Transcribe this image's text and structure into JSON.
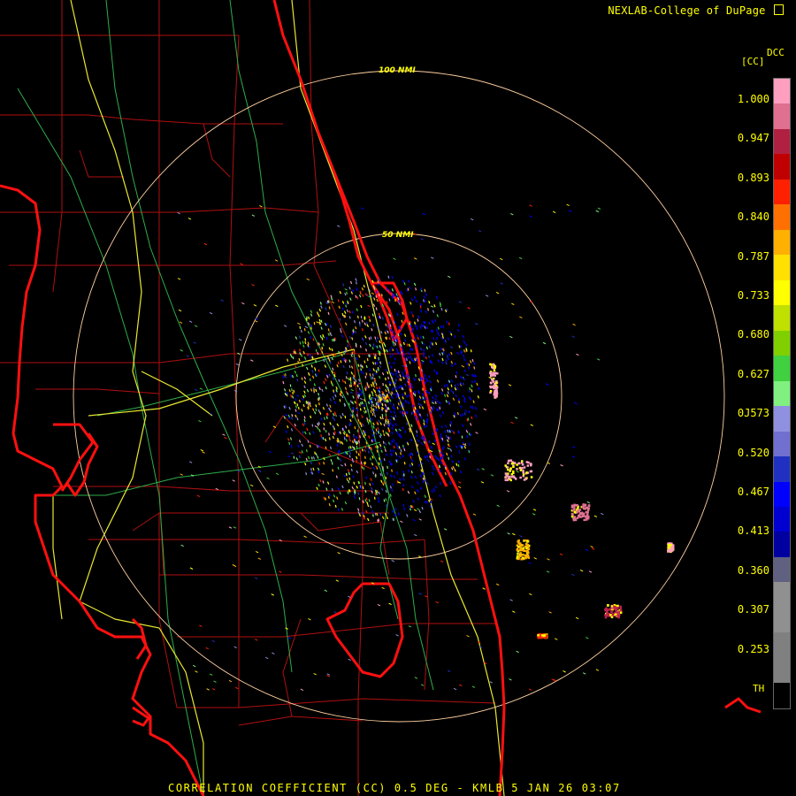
{
  "header": {
    "credit": "NEXLAB-College of DuPage",
    "credit_icon": "dcc-logo-mark"
  },
  "legend": {
    "unit": "[CC]",
    "logo_text": "DCC",
    "bottom_label": "TH",
    "ticks": [
      "1.000",
      "0.947",
      "0.893",
      "0.840",
      "0.787",
      "0.733",
      "0.680",
      "0.627",
      "0J573",
      "0.520",
      "0.467",
      "0.413",
      "0.360",
      "0.307",
      "0.253"
    ],
    "colors": [
      "#ff9fc0",
      "#e07090",
      "#b02040",
      "#c00000",
      "#ff2000",
      "#ff7000",
      "#ffb000",
      "#ffe000",
      "#ffff00",
      "#c0e000",
      "#80d000",
      "#40d040",
      "#80f080",
      "#9090e0",
      "#7070d0",
      "#2030c0",
      "#0000ff",
      "#0000d0",
      "#0000a0",
      "#606080",
      "#909090",
      "#909090",
      "#808080",
      "#808080",
      "#000000"
    ]
  },
  "map": {
    "range_ring_labels": [
      "100 NMI",
      "50 NMI"
    ],
    "radar_site": "KMLB"
  },
  "footer": {
    "product": "CORRELATION COEFFICIENT (CC) 0.5 DEG - KMLB 5 JAN 26 03:07"
  }
}
